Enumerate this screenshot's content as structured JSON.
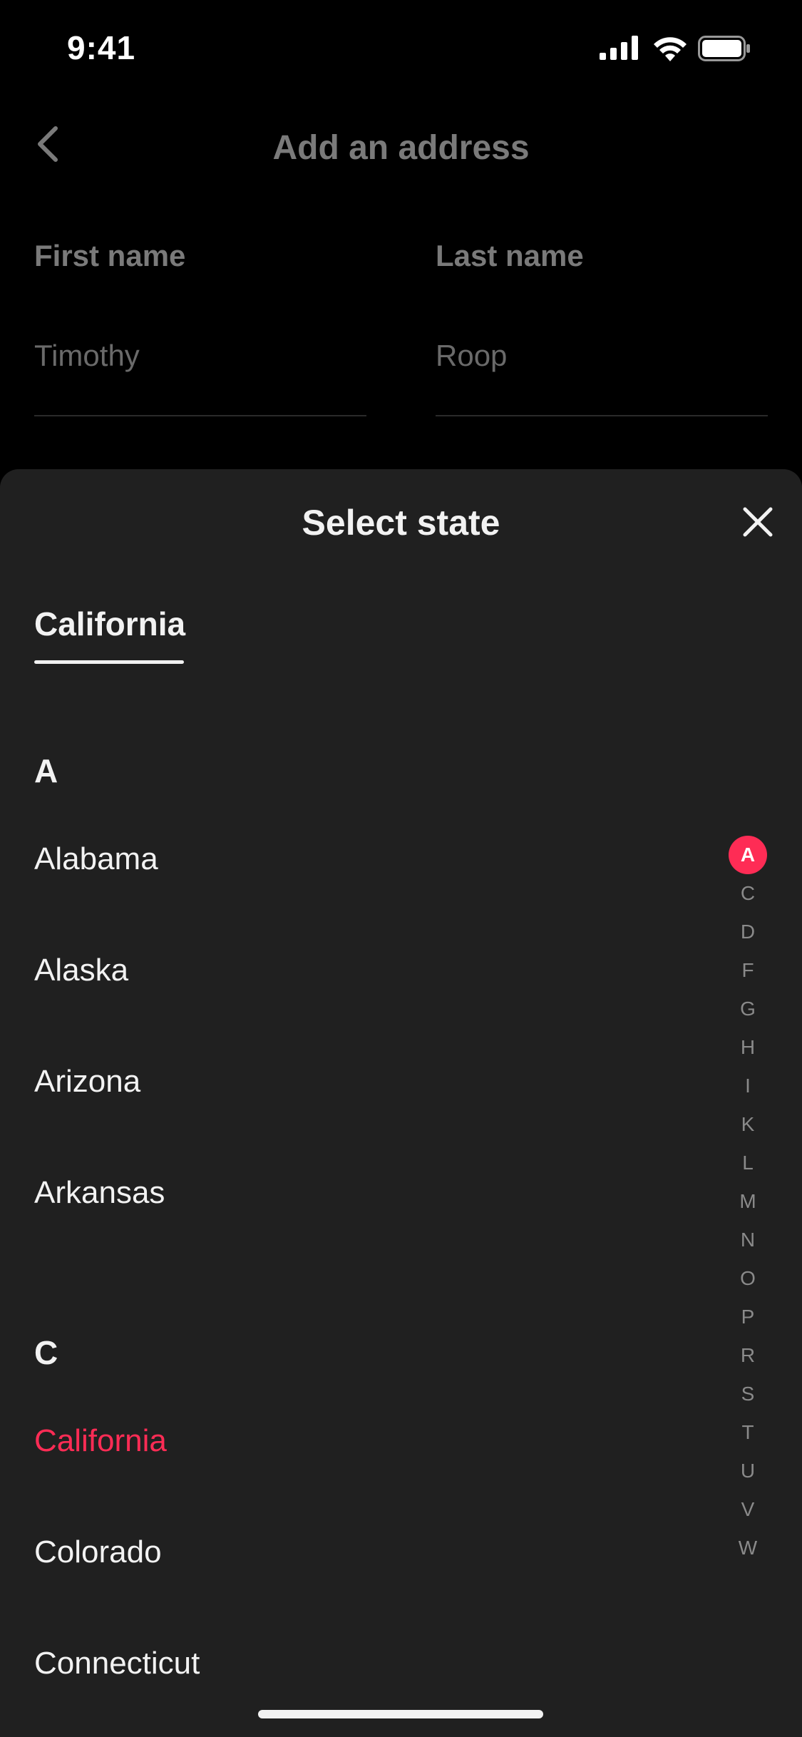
{
  "status_bar": {
    "time": "9:41"
  },
  "header": {
    "title": "Add an address"
  },
  "form": {
    "first_name": {
      "label": "First name",
      "value": "Timothy"
    },
    "last_name": {
      "label": "Last name",
      "value": "Roop"
    }
  },
  "sheet": {
    "title": "Select state",
    "selected_tab": "California",
    "sections": [
      {
        "letter": "A",
        "items": [
          "Alabama",
          "Alaska",
          "Arizona",
          "Arkansas"
        ]
      },
      {
        "letter": "C",
        "items": [
          "California",
          "Colorado",
          "Connecticut"
        ]
      }
    ],
    "active_item": "California",
    "alphabet_index": [
      "A",
      "C",
      "D",
      "F",
      "G",
      "H",
      "I",
      "K",
      "L",
      "M",
      "N",
      "O",
      "P",
      "R",
      "S",
      "T",
      "U",
      "V",
      "W"
    ],
    "active_index_letter": "A"
  },
  "colors": {
    "accent": "#fe2c55",
    "sheet_bg": "#202020",
    "page_bg": "#000000"
  }
}
